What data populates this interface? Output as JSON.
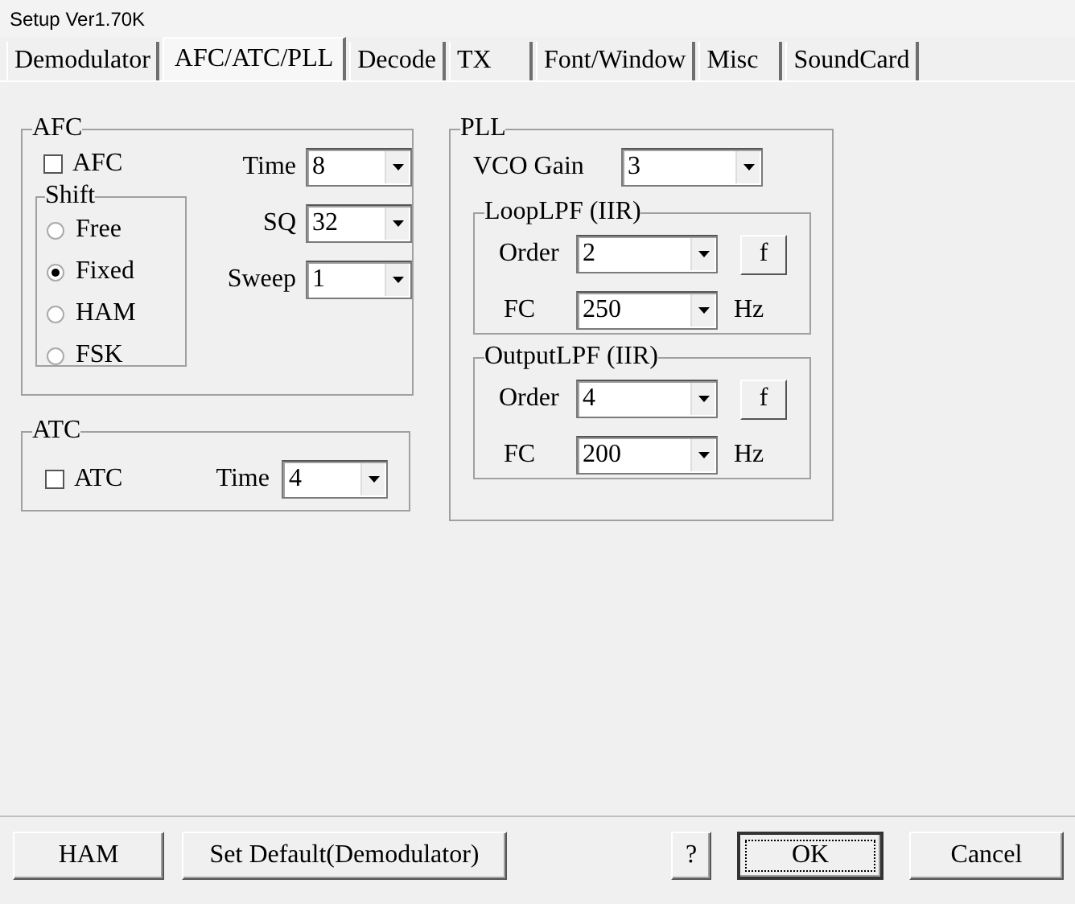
{
  "window": {
    "title": "Setup Ver1.70K"
  },
  "tabs": [
    {
      "label": "Demodulator",
      "selected": false
    },
    {
      "label": "AFC/ATC/PLL",
      "selected": true
    },
    {
      "label": "Decode",
      "selected": false
    },
    {
      "label": "TX",
      "selected": false
    },
    {
      "label": "Font/Window",
      "selected": false
    },
    {
      "label": "Misc",
      "selected": false
    },
    {
      "label": "SoundCard",
      "selected": false
    }
  ],
  "afc": {
    "title": "AFC",
    "checkbox": {
      "label": "AFC",
      "checked": false
    },
    "shift": {
      "title": "Shift",
      "options": [
        {
          "label": "Free",
          "selected": false
        },
        {
          "label": "Fixed",
          "selected": true
        },
        {
          "label": "HAM",
          "selected": false
        },
        {
          "label": "FSK",
          "selected": false
        }
      ]
    },
    "fields": [
      {
        "label": "Time",
        "value": "8"
      },
      {
        "label": "SQ",
        "value": "32"
      },
      {
        "label": "Sweep",
        "value": "1"
      }
    ]
  },
  "atc": {
    "title": "ATC",
    "checkbox": {
      "label": "ATC",
      "checked": false
    },
    "field": {
      "label": "Time",
      "value": "4"
    }
  },
  "pll": {
    "title": "PLL",
    "vco": {
      "label": "VCO Gain",
      "value": "3"
    },
    "filters": [
      {
        "title": "LoopLPF (IIR)",
        "order": {
          "label": "Order",
          "value": "2"
        },
        "button": "f",
        "fc": {
          "label": "FC",
          "value": "250",
          "unit": "Hz"
        }
      },
      {
        "title": "OutputLPF (IIR)",
        "order": {
          "label": "Order",
          "value": "4"
        },
        "button": "f",
        "fc": {
          "label": "FC",
          "value": "200",
          "unit": "Hz"
        }
      }
    ]
  },
  "buttons": [
    {
      "label": "HAM",
      "default": false
    },
    {
      "label": "Set Default(Demodulator)",
      "default": false
    },
    {
      "label": "?",
      "default": false
    },
    {
      "label": "OK",
      "default": true
    },
    {
      "label": "Cancel",
      "default": false
    }
  ]
}
